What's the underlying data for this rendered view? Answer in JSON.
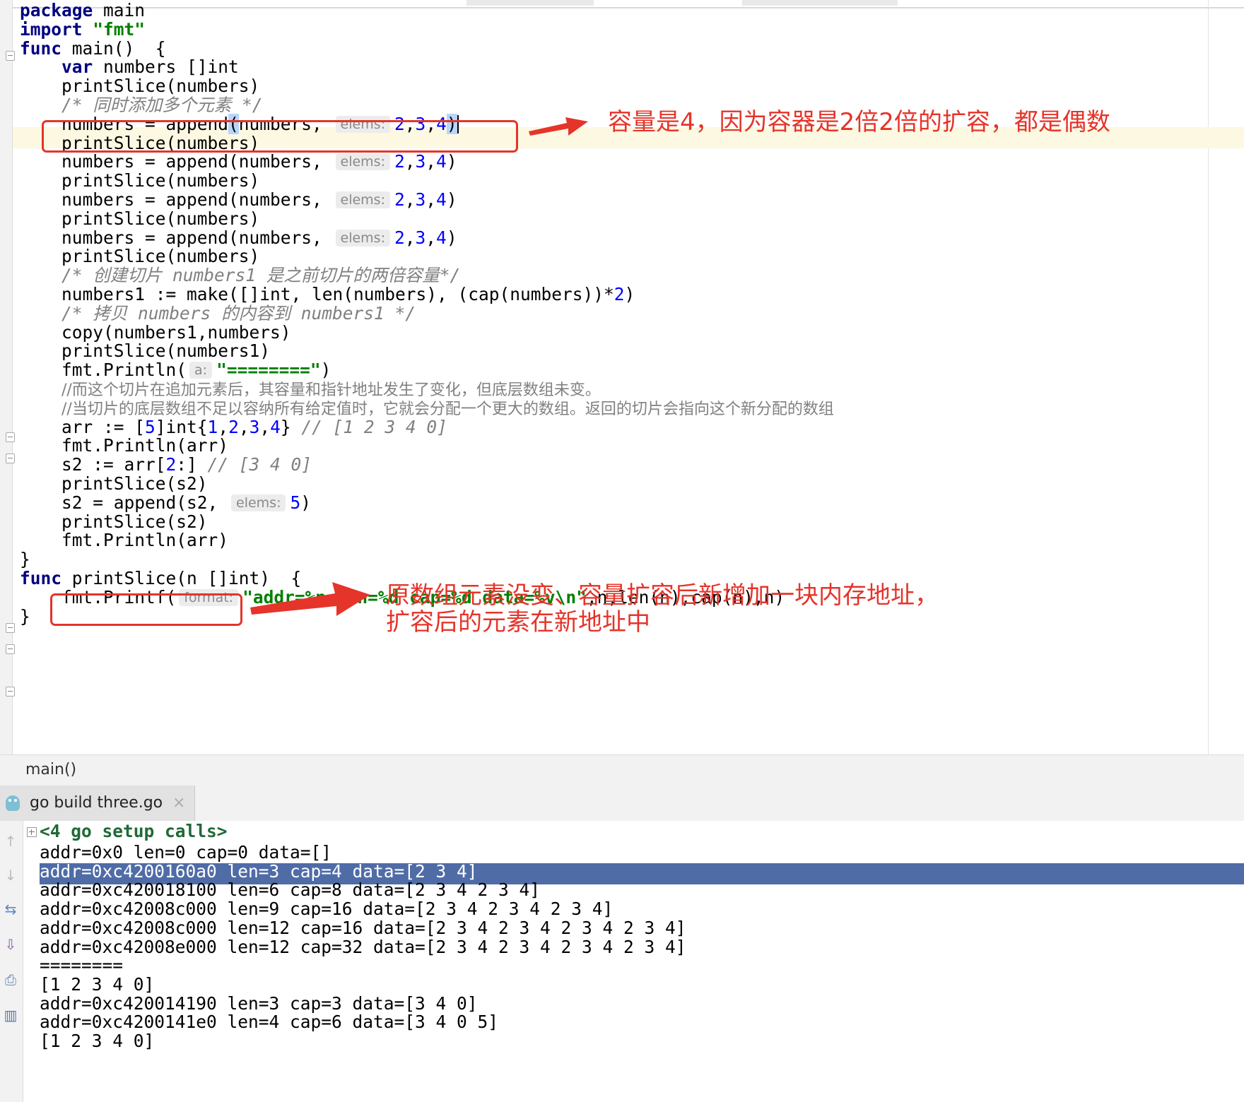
{
  "editor": {
    "lines": [
      {
        "parts": [
          {
            "t": "package",
            "c": "kw"
          },
          {
            "t": " main"
          }
        ]
      },
      {
        "parts": [
          {
            "t": "import",
            "c": "kw"
          },
          {
            "t": " "
          },
          {
            "t": "\"fmt\"",
            "c": "str"
          }
        ]
      },
      {
        "parts": [
          {
            "t": "func",
            "c": "kw"
          },
          {
            "t": " main()  {"
          }
        ]
      },
      {
        "parts": [
          {
            "t": "    "
          },
          {
            "t": "var",
            "c": "kw"
          },
          {
            "t": " numbers []int"
          }
        ]
      },
      {
        "parts": [
          {
            "t": "    printSlice(numbers)"
          }
        ]
      },
      {
        "parts": [
          {
            "t": "    "
          },
          {
            "t": "/* 同时添加多个元素 */",
            "c": "cm"
          }
        ]
      },
      {
        "parts": [
          {
            "t": "    numbers = append"
          },
          {
            "t": "(",
            "c": "bm"
          },
          {
            "t": "numbers, "
          },
          {
            "t": "elems:",
            "c": "hint"
          },
          {
            "t": "2",
            "c": "num"
          },
          {
            "t": ","
          },
          {
            "t": "3",
            "c": "num"
          },
          {
            "t": ","
          },
          {
            "t": "4",
            "c": "num"
          },
          {
            "t": ")",
            "c": "bm"
          },
          {
            "t": "",
            "c": "caret"
          }
        ]
      },
      {
        "parts": [
          {
            "t": "    printSlice(numbers)"
          }
        ]
      },
      {
        "parts": [
          {
            "t": "    numbers = append(numbers, "
          },
          {
            "t": "elems:",
            "c": "hint"
          },
          {
            "t": "2",
            "c": "num"
          },
          {
            "t": ","
          },
          {
            "t": "3",
            "c": "num"
          },
          {
            "t": ","
          },
          {
            "t": "4",
            "c": "num"
          },
          {
            "t": ")"
          }
        ]
      },
      {
        "parts": [
          {
            "t": "    printSlice(numbers)"
          }
        ]
      },
      {
        "parts": [
          {
            "t": "    numbers = append(numbers, "
          },
          {
            "t": "elems:",
            "c": "hint"
          },
          {
            "t": "2",
            "c": "num"
          },
          {
            "t": ","
          },
          {
            "t": "3",
            "c": "num"
          },
          {
            "t": ","
          },
          {
            "t": "4",
            "c": "num"
          },
          {
            "t": ")"
          }
        ]
      },
      {
        "parts": [
          {
            "t": "    printSlice(numbers)"
          }
        ]
      },
      {
        "parts": [
          {
            "t": "    numbers = append(numbers, "
          },
          {
            "t": "elems:",
            "c": "hint"
          },
          {
            "t": "2",
            "c": "num"
          },
          {
            "t": ","
          },
          {
            "t": "3",
            "c": "num"
          },
          {
            "t": ","
          },
          {
            "t": "4",
            "c": "num"
          },
          {
            "t": ")"
          }
        ]
      },
      {
        "parts": [
          {
            "t": "    printSlice(numbers)"
          }
        ]
      },
      {
        "parts": [
          {
            "t": "    "
          },
          {
            "t": "/* 创建切片 numbers1 是之前切片的两倍容量*/",
            "c": "cm"
          }
        ]
      },
      {
        "parts": [
          {
            "t": "    numbers1 := make([]int, len(numbers), (cap(numbers))*"
          },
          {
            "t": "2",
            "c": "num"
          },
          {
            "t": ")"
          }
        ]
      },
      {
        "parts": [
          {
            "t": "    "
          },
          {
            "t": "/* 拷贝 numbers 的内容到 numbers1 */",
            "c": "cm"
          }
        ]
      },
      {
        "parts": [
          {
            "t": "    copy(numbers1,numbers)"
          }
        ]
      },
      {
        "parts": [
          {
            "t": "    printSlice(numbers1)"
          }
        ]
      },
      {
        "parts": [
          {
            "t": "    fmt.Println("
          },
          {
            "t": "a:",
            "c": "hint"
          },
          {
            "t": "\"========\"",
            "c": "str"
          },
          {
            "t": ")"
          }
        ]
      },
      {
        "parts": [
          {
            "t": "    "
          },
          {
            "t": "//而这个切片在追加元素后，其容量和指针地址发生了变化，但底层数组未变。",
            "c": "cmn"
          }
        ]
      },
      {
        "parts": [
          {
            "t": "    "
          },
          {
            "t": "//当切片的底层数组不足以容纳所有给定值时，它就会分配一个更大的数组。返回的切片会指向这个新分配的数组",
            "c": "cmn"
          }
        ]
      },
      {
        "parts": [
          {
            "t": "    arr := ["
          },
          {
            "t": "5",
            "c": "num"
          },
          {
            "t": "]int{"
          },
          {
            "t": "1",
            "c": "num"
          },
          {
            "t": ","
          },
          {
            "t": "2",
            "c": "num"
          },
          {
            "t": ","
          },
          {
            "t": "3",
            "c": "num"
          },
          {
            "t": ","
          },
          {
            "t": "4",
            "c": "num"
          },
          {
            "t": "} "
          },
          {
            "t": "// [1 2 3 4 0]",
            "c": "cm"
          }
        ]
      },
      {
        "parts": [
          {
            "t": "    fmt.Println(arr)"
          }
        ]
      },
      {
        "parts": [
          {
            "t": "    s2 := arr["
          },
          {
            "t": "2",
            "c": "num"
          },
          {
            "t": ":] "
          },
          {
            "t": "// [3 4 0]",
            "c": "cm"
          }
        ]
      },
      {
        "parts": [
          {
            "t": "    printSlice(s2)"
          }
        ]
      },
      {
        "parts": [
          {
            "t": "    s2 = append(s2, "
          },
          {
            "t": "elems:",
            "c": "hint"
          },
          {
            "t": "5",
            "c": "num"
          },
          {
            "t": ")"
          }
        ]
      },
      {
        "parts": [
          {
            "t": "    printSlice(s2)"
          }
        ]
      },
      {
        "parts": [
          {
            "t": "    fmt.Println(arr)"
          }
        ]
      },
      {
        "parts": [
          {
            "t": "}"
          }
        ]
      },
      {
        "parts": [
          {
            "t": "func",
            "c": "kw"
          },
          {
            "t": " printSlice(n []int)  {"
          }
        ]
      },
      {
        "parts": [
          {
            "t": "    fmt.Printf("
          },
          {
            "t": "format:",
            "c": "hint"
          },
          {
            "t": "\"addr=%p len=%d cap=%d data=%v\\n\"",
            "c": "str"
          },
          {
            "t": ",n,len(n),cap(n),n)"
          }
        ]
      },
      {
        "parts": [
          {
            "t": "}"
          }
        ]
      }
    ]
  },
  "annotations": {
    "capacity_note": "容量是4，因为容器是2倍2倍的扩容，都是偶数",
    "array_note_line1": "原数组元素没变、容量扩容后新增加一块内存地址，",
    "array_note_line2": "扩容后的元素在新地址中"
  },
  "breadcrumb": {
    "label": "main()"
  },
  "run_tab": {
    "label": "go build three.go",
    "close": "×",
    "icon": "gopher-icon"
  },
  "console": {
    "setup_calls": "<4 go setup calls>",
    "lines": [
      "addr=0x0 len=0 cap=0 data=[]",
      "addr=0xc4200160a0 len=3 cap=4 data=[2 3 4]",
      "addr=0xc420018100 len=6 cap=8 data=[2 3 4 2 3 4]",
      "addr=0xc42008c000 len=9 cap=16 data=[2 3 4 2 3 4 2 3 4]",
      "addr=0xc42008c000 len=12 cap=16 data=[2 3 4 2 3 4 2 3 4 2 3 4]",
      "addr=0xc42008e000 len=12 cap=32 data=[2 3 4 2 3 4 2 3 4 2 3 4]",
      "========",
      "[1 2 3 4 0]",
      "addr=0xc420014190 len=3 cap=3 data=[3 4 0]",
      "addr=0xc4200141e0 len=4 cap=6 data=[3 4 0 5]",
      "[1 2 3 4 0]"
    ],
    "selected_index": 1
  },
  "colors": {
    "accent_red": "#e5342a",
    "selection": "#4f6ca7",
    "keyword": "#000080",
    "string": "#008000",
    "number": "#0000ff"
  }
}
